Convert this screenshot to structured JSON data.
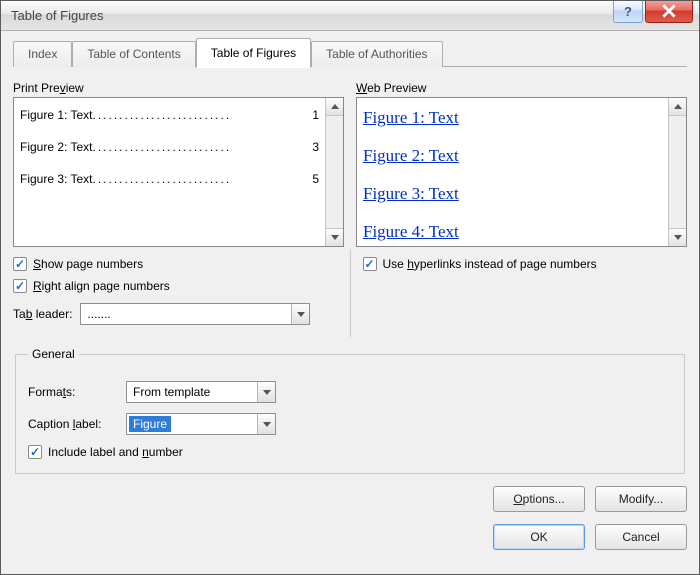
{
  "window": {
    "title": "Table of Figures"
  },
  "tabs": {
    "index": "Index",
    "toc": "Table of Contents",
    "tof": "Table of Figures",
    "toa": "Table of Authorities"
  },
  "printPreview": {
    "label": "Print Preview",
    "rows": [
      {
        "label": "Figure 1: Text",
        "page": "1"
      },
      {
        "label": "Figure 2: Text",
        "page": "3"
      },
      {
        "label": "Figure 3: Text",
        "page": "5"
      }
    ]
  },
  "webPreview": {
    "label": "Web Preview",
    "rows": [
      "Figure 1: Text",
      "Figure 2: Text",
      "Figure 3: Text",
      "Figure 4: Text"
    ]
  },
  "options": {
    "showPageNumbers": {
      "label": "Show page numbers",
      "checked": true
    },
    "rightAlign": {
      "label": "Right align page numbers",
      "checked": true
    },
    "useHyperlinks": {
      "label": "Use hyperlinks instead of page numbers",
      "checked": true
    },
    "tabLeaderLabel": "Tab leader:",
    "tabLeaderValue": "......."
  },
  "general": {
    "legend": "General",
    "formatsLabel": "Formats:",
    "formatsValue": "From template",
    "captionLabelLabel": "Caption label:",
    "captionLabelValue": "Figure",
    "includeLabel": {
      "label": "Include label and number",
      "checked": true
    }
  },
  "buttons": {
    "options": "Options...",
    "modify": "Modify...",
    "ok": "OK",
    "cancel": "Cancel"
  }
}
